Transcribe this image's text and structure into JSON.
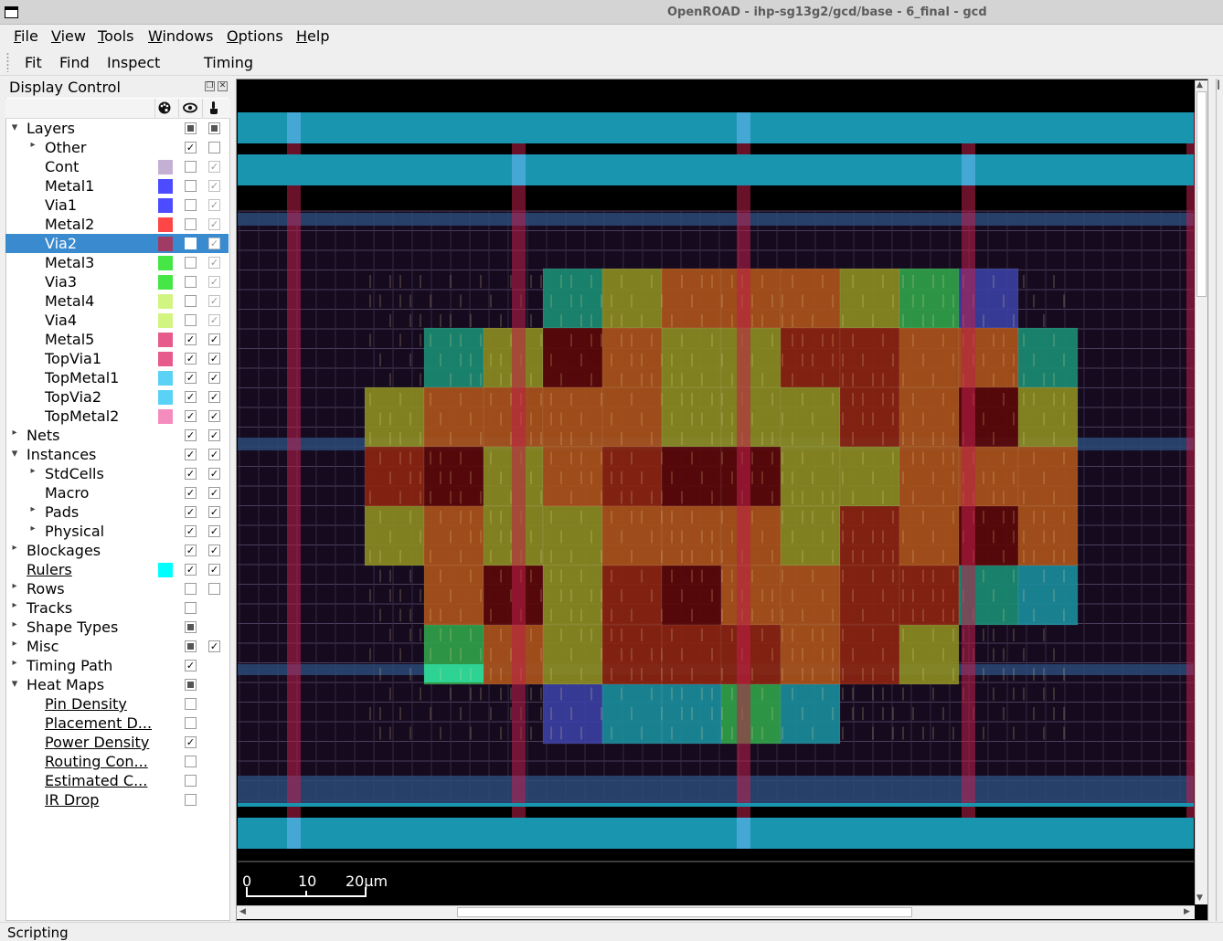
{
  "window": {
    "title": "OpenROAD - ihp-sg13g2/gcd/base - 6_final - gcd"
  },
  "menu": [
    {
      "accel": "F",
      "rest": "ile"
    },
    {
      "accel": "V",
      "rest": "iew"
    },
    {
      "accel": "T",
      "rest": "ools"
    },
    {
      "accel": "W",
      "rest": "indows"
    },
    {
      "accel": "O",
      "rest": "ptions"
    },
    {
      "accel": "H",
      "rest": "elp"
    }
  ],
  "toolbar": {
    "fit": "Fit",
    "find": "Find",
    "inspect": "Inspect",
    "timing": "Timing"
  },
  "dock": {
    "title": "Display Control",
    "header_icons": [
      "palette-icon",
      "eye-icon",
      "pointer-hand-icon"
    ],
    "rows": [
      {
        "label": "Layers",
        "level": 0,
        "arrow": "down",
        "c1": "partial",
        "c2": "partial"
      },
      {
        "label": "Other",
        "level": 1,
        "arrow": "right",
        "c1": "checked",
        "c2": "unchecked"
      },
      {
        "label": "Cont",
        "level": 1,
        "color": "#c4b0d2",
        "c1": "unchecked",
        "c2": "disabled"
      },
      {
        "label": "Metal1",
        "level": 1,
        "color": "#4b4bff",
        "c1": "unchecked",
        "c2": "disabled"
      },
      {
        "label": "Via1",
        "level": 1,
        "color": "#4b4bff",
        "c1": "unchecked",
        "c2": "disabled"
      },
      {
        "label": "Metal2",
        "level": 1,
        "color": "#ff4646",
        "c1": "unchecked",
        "c2": "disabled"
      },
      {
        "label": "Via2",
        "level": 1,
        "color": "#a03c64",
        "c1": "unchecked",
        "c2": "disabled",
        "selected": true
      },
      {
        "label": "Metal3",
        "level": 1,
        "color": "#46e646",
        "c1": "unchecked",
        "c2": "disabled"
      },
      {
        "label": "Via3",
        "level": 1,
        "color": "#46e646",
        "c1": "unchecked",
        "c2": "disabled"
      },
      {
        "label": "Metal4",
        "level": 1,
        "color": "#d2f582",
        "c1": "unchecked",
        "c2": "disabled"
      },
      {
        "label": "Via4",
        "level": 1,
        "color": "#d2f582",
        "c1": "unchecked",
        "c2": "disabled"
      },
      {
        "label": "Metal5",
        "level": 1,
        "color": "#e65a8c",
        "c1": "checked",
        "c2": "checked"
      },
      {
        "label": "TopVia1",
        "level": 1,
        "color": "#e65a8c",
        "c1": "checked",
        "c2": "checked"
      },
      {
        "label": "TopMetal1",
        "level": 1,
        "color": "#5ad2f5",
        "c1": "checked",
        "c2": "checked"
      },
      {
        "label": "TopVia2",
        "level": 1,
        "color": "#5ad2f5",
        "c1": "checked",
        "c2": "checked"
      },
      {
        "label": "TopMetal2",
        "level": 1,
        "color": "#f58cbe",
        "c1": "checked",
        "c2": "checked"
      },
      {
        "label": "Nets",
        "level": 0,
        "arrow": "right",
        "c1": "checked",
        "c2": "checked"
      },
      {
        "label": "Instances",
        "level": 0,
        "arrow": "down",
        "c1": "checked",
        "c2": "checked"
      },
      {
        "label": "StdCells",
        "level": 1,
        "arrow": "right",
        "c1": "checked",
        "c2": "checked"
      },
      {
        "label": "Macro",
        "level": 1,
        "c1": "checked",
        "c2": "checked"
      },
      {
        "label": "Pads",
        "level": 1,
        "arrow": "right",
        "c1": "checked",
        "c2": "checked"
      },
      {
        "label": "Physical",
        "level": 1,
        "arrow": "right",
        "c1": "checked",
        "c2": "checked"
      },
      {
        "label": "Blockages",
        "level": 0,
        "arrow": "right",
        "c1": "checked",
        "c2": "checked"
      },
      {
        "label": "Rulers",
        "level": 0,
        "link": true,
        "color": "#00ffff",
        "c1": "checked",
        "c2": "checked"
      },
      {
        "label": "Rows",
        "level": 0,
        "arrow": "right",
        "c1": "unchecked",
        "c2": "unchecked"
      },
      {
        "label": "Tracks",
        "level": 0,
        "arrow": "right",
        "c1": "unchecked"
      },
      {
        "label": "Shape Types",
        "level": 0,
        "arrow": "right",
        "c1": "partial"
      },
      {
        "label": "Misc",
        "level": 0,
        "arrow": "right",
        "c1": "partial",
        "c2": "checked"
      },
      {
        "label": "Timing Path",
        "level": 0,
        "arrow": "right",
        "c1": "checked"
      },
      {
        "label": "Heat Maps",
        "level": 0,
        "arrow": "down",
        "c1": "partial"
      },
      {
        "label": "Pin Density",
        "level": 1,
        "link": true,
        "c1": "unchecked"
      },
      {
        "label": "Placement D...",
        "level": 1,
        "link": true,
        "c1": "unchecked"
      },
      {
        "label": "Power Density",
        "level": 1,
        "link": true,
        "c1": "checked"
      },
      {
        "label": "Routing Con...",
        "level": 1,
        "link": true,
        "c1": "unchecked"
      },
      {
        "label": "Estimated C...",
        "level": 1,
        "link": true,
        "c1": "unchecked"
      },
      {
        "label": "IR Drop",
        "level": 1,
        "link": true,
        "c1": "unchecked"
      }
    ]
  },
  "viewer": {
    "scale_labels": [
      "0",
      "10",
      "20µm"
    ],
    "heatmap_colors": {
      "teal": "#1a8a72",
      "blue": "#3a3fa0",
      "green": "#2fa04a",
      "olive": "#8a8a22",
      "orange": "#a9521a",
      "red": "#8a2410",
      "darkred": "#5a0808",
      "cyan": "#1a8a9a",
      "mint": "#2fd89a"
    },
    "rail_color": "#1a95b0",
    "background": "#160a1e"
  },
  "status": {
    "scripting": "Scripting"
  },
  "right_label": "I"
}
